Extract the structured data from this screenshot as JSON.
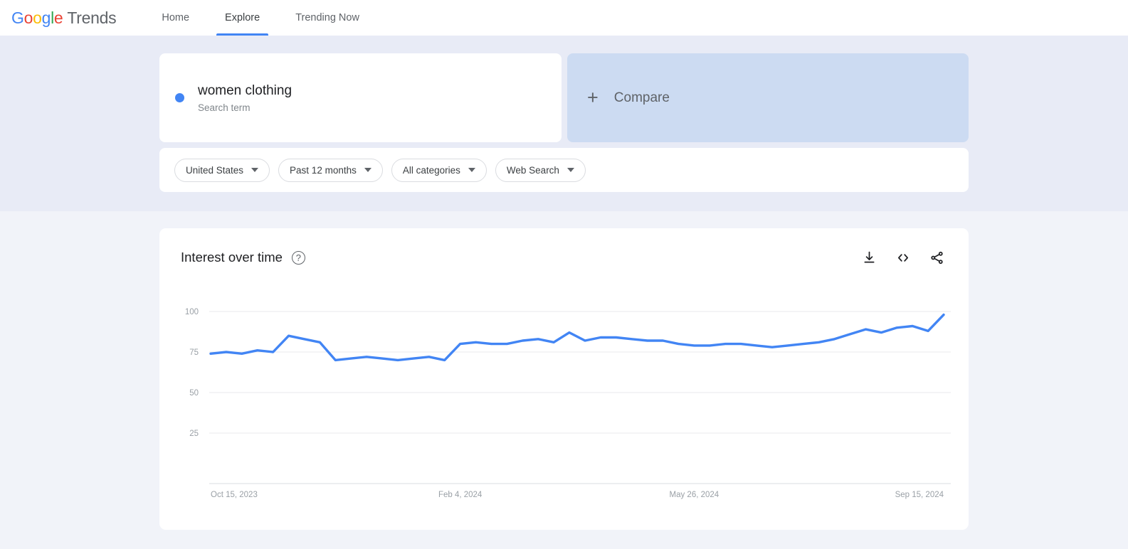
{
  "header": {
    "logo": {
      "word1": "Google",
      "word2": "Trends"
    },
    "nav": [
      {
        "label": "Home",
        "active": false
      },
      {
        "label": "Explore",
        "active": true
      },
      {
        "label": "Trending Now",
        "active": false
      }
    ]
  },
  "search_terms": [
    {
      "title": "women clothing",
      "subtitle": "Search term",
      "color": "#4285F4"
    }
  ],
  "compare": {
    "label": "Compare",
    "plus": "+"
  },
  "filters": [
    {
      "name": "location",
      "label": "United States"
    },
    {
      "name": "time-range",
      "label": "Past 12 months"
    },
    {
      "name": "category",
      "label": "All categories"
    },
    {
      "name": "search-type",
      "label": "Web Search"
    }
  ],
  "chart_card": {
    "title": "Interest over time",
    "help": "?",
    "actions": [
      {
        "name": "download-icon",
        "label": "Download"
      },
      {
        "name": "embed-code-icon",
        "label": "Embed"
      },
      {
        "name": "share-icon",
        "label": "Share"
      }
    ]
  },
  "chart_data": {
    "type": "line",
    "title": "Interest over time",
    "xlabel": "",
    "ylabel": "",
    "ylim": [
      0,
      100
    ],
    "yticks": [
      100,
      75,
      50,
      25
    ],
    "xticks": [
      "Oct 15, 2023",
      "Feb 4, 2024",
      "May 26, 2024",
      "Sep 15, 2024"
    ],
    "grid": true,
    "legend": false,
    "series": [
      {
        "name": "women clothing",
        "color": "#4285F4",
        "values": [
          74,
          75,
          74,
          76,
          75,
          85,
          83,
          81,
          70,
          71,
          72,
          71,
          70,
          71,
          72,
          70,
          80,
          81,
          80,
          80,
          82,
          83,
          81,
          87,
          82,
          84,
          84,
          83,
          82,
          82,
          80,
          79,
          79,
          80,
          80,
          79,
          78,
          79,
          80,
          81,
          83,
          86,
          89,
          87,
          90,
          91,
          88,
          98
        ]
      }
    ]
  }
}
